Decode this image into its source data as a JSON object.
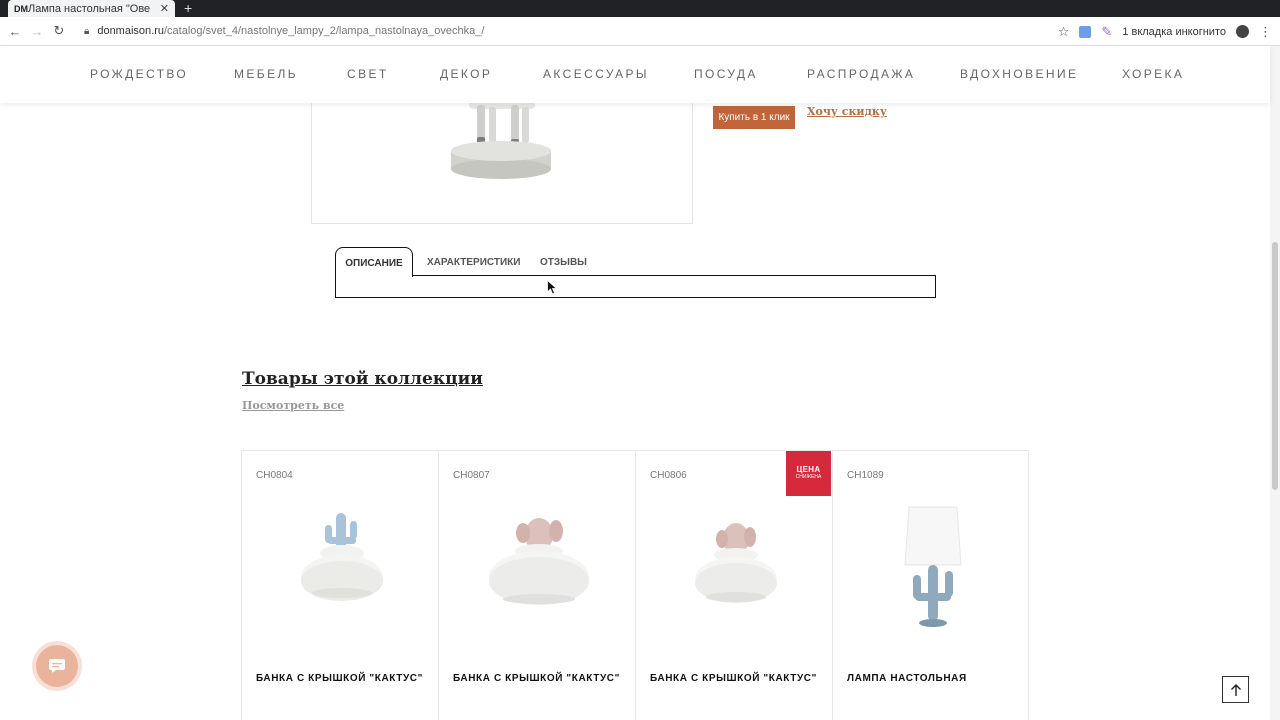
{
  "browser": {
    "tab_title": "Лампа настольная \"Ове",
    "tab_favicon": "DM",
    "url_host": "donmaison.ru",
    "url_path": "/catalog/svet_4/nastolnye_lampy_2/lampa_nastolnaya_ovechka_/",
    "incognito_label": "1 вкладка инкогнито"
  },
  "nav": {
    "items": [
      "РОЖДЕСТВО",
      "МЕБЕЛЬ",
      "СВЕТ",
      "ДЕКОР",
      "АКСЕССУАРЫ",
      "ПОСУДА",
      "РАСПРОДАЖА",
      "ВДОХНОВЕНИЕ",
      "ХОРЕКА"
    ]
  },
  "product": {
    "buy_one_click": "Купить в 1 клик",
    "want_discount": "Хочу скидку"
  },
  "tabs": {
    "items": [
      "ОПИСАНИЕ",
      "ХАРАКТЕРИСТИКИ",
      "ОТЗЫВЫ"
    ],
    "active_index": 0
  },
  "collection": {
    "title": "Товары этой коллекции",
    "view_all": "Посмотреть все",
    "products": [
      {
        "sku": "CH0804",
        "name": "БАНКА С КРЫШКОЙ \"КАКТУС\"",
        "image": "cactus-jar-blue",
        "badge": null
      },
      {
        "sku": "CH0807",
        "name": "БАНКА С КРЫШКОЙ \"КАКТУС\"",
        "image": "cactus-jar-pink-large",
        "badge": null
      },
      {
        "sku": "CH0806",
        "name": "БАНКА С КРЫШКОЙ \"КАКТУС\"",
        "image": "cactus-jar-pink",
        "badge": {
          "line1": "ЦЕНА",
          "line2": "СНИЖЕНА"
        }
      },
      {
        "sku": "CH1089",
        "name": "ЛАМПА НАСТОЛЬНАЯ",
        "image": "cactus-lamp",
        "badge": null
      }
    ]
  },
  "colors": {
    "accent": "#c0653a",
    "link": "#b5703f",
    "sale_badge": "#d6293c",
    "chat": "#eab39b"
  },
  "icons": {
    "back": "arrow-left-icon",
    "forward": "arrow-right-icon",
    "reload": "reload-icon",
    "lock": "lock-icon",
    "star": "star-icon",
    "chat": "chat-icon",
    "to_top": "arrow-up-icon"
  }
}
